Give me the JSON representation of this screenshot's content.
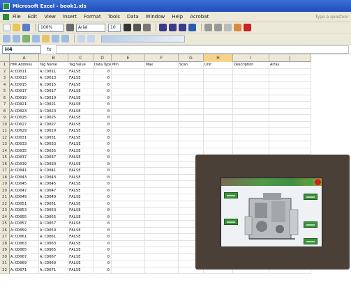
{
  "window": {
    "title": "Microsoft Excel - book1.xls"
  },
  "menu": {
    "items": [
      "File",
      "Edit",
      "View",
      "Insert",
      "Format",
      "Tools",
      "Data",
      "Window",
      "Help",
      "Acrobat"
    ],
    "help_placeholder": "Type a question"
  },
  "toolbar": {
    "zoom": "100%",
    "font": "Arial",
    "size": "10"
  },
  "formula": {
    "name_box": "H4",
    "fx": "fx",
    "value": ""
  },
  "columns": [
    "A",
    "B",
    "C",
    "D",
    "E",
    "F",
    "G",
    "H",
    "I",
    "J"
  ],
  "selected_column": "H",
  "header_row": [
    "HMI Address",
    "Tag Name",
    "Tag Value",
    "Data Type",
    "Min",
    "Max",
    "Scan",
    "Unit",
    "Description",
    "Array"
  ],
  "rows": [
    {
      "n": "2",
      "a": "A:CD011",
      "b": "A:CD011",
      "c": "FALSE",
      "d": "0"
    },
    {
      "n": "3",
      "a": "A:CD013",
      "b": "A:CD013",
      "c": "FALSE",
      "d": "0"
    },
    {
      "n": "4",
      "a": "A:CD015",
      "b": "A:CD015",
      "c": "FALSE",
      "d": "0"
    },
    {
      "n": "5",
      "a": "A:CD017",
      "b": "A:CD017",
      "c": "FALSE",
      "d": "0"
    },
    {
      "n": "6",
      "a": "A:CD019",
      "b": "A:CD019",
      "c": "FALSE",
      "d": "0"
    },
    {
      "n": "7",
      "a": "A:CD021",
      "b": "A:CD021",
      "c": "FALSE",
      "d": "0"
    },
    {
      "n": "8",
      "a": "A:CD023",
      "b": "A:CD023",
      "c": "FALSE",
      "d": "0"
    },
    {
      "n": "9",
      "a": "A:CD025",
      "b": "A:CD025",
      "c": "FALSE",
      "d": "0"
    },
    {
      "n": "10",
      "a": "A:CD027",
      "b": "A:CD027",
      "c": "FALSE",
      "d": "0"
    },
    {
      "n": "11",
      "a": "A:CD029",
      "b": "A:CD029",
      "c": "FALSE",
      "d": "0"
    },
    {
      "n": "12",
      "a": "A:CD031",
      "b": "A:CD031",
      "c": "FALSE",
      "d": "0"
    },
    {
      "n": "13",
      "a": "A:CD033",
      "b": "A:CD033",
      "c": "FALSE",
      "d": "0"
    },
    {
      "n": "14",
      "a": "A:CD035",
      "b": "A:CD035",
      "c": "FALSE",
      "d": "0"
    },
    {
      "n": "15",
      "a": "A:CD037",
      "b": "A:CD037",
      "c": "FALSE",
      "d": "0"
    },
    {
      "n": "16",
      "a": "A:CD039",
      "b": "A:CD039",
      "c": "FALSE",
      "d": "0"
    },
    {
      "n": "17",
      "a": "A:CD041",
      "b": "A:CD041",
      "c": "FALSE",
      "d": "0"
    },
    {
      "n": "18",
      "a": "A:CD043",
      "b": "A:CD043",
      "c": "FALSE",
      "d": "0"
    },
    {
      "n": "19",
      "a": "A:CD045",
      "b": "A:CD045",
      "c": "FALSE",
      "d": "0"
    },
    {
      "n": "20",
      "a": "A:CD047",
      "b": "A:CD047",
      "c": "FALSE",
      "d": "0"
    },
    {
      "n": "21",
      "a": "A:CD049",
      "b": "A:CD049",
      "c": "FALSE",
      "d": "0"
    },
    {
      "n": "22",
      "a": "A:CD051",
      "b": "A:CD051",
      "c": "FALSE",
      "d": "0"
    },
    {
      "n": "23",
      "a": "A:CD053",
      "b": "A:CD053",
      "c": "FALSE",
      "d": "0"
    },
    {
      "n": "24",
      "a": "A:CD055",
      "b": "A:CD055",
      "c": "FALSE",
      "d": "0"
    },
    {
      "n": "25",
      "a": "A:CD057",
      "b": "A:CD057",
      "c": "FALSE",
      "d": "0"
    },
    {
      "n": "26",
      "a": "A:CD059",
      "b": "A:CD059",
      "c": "FALSE",
      "d": "0"
    },
    {
      "n": "27",
      "a": "A:CD061",
      "b": "A:CD061",
      "c": "FALSE",
      "d": "0"
    },
    {
      "n": "28",
      "a": "A:CD063",
      "b": "A:CD063",
      "c": "FALSE",
      "d": "0"
    },
    {
      "n": "29",
      "a": "A:CD065",
      "b": "A:CD065",
      "c": "FALSE",
      "d": "0"
    },
    {
      "n": "30",
      "a": "A:CD067",
      "b": "A:CD067",
      "c": "FALSE",
      "d": "0"
    },
    {
      "n": "31",
      "a": "A:CD069",
      "b": "A:CD069",
      "c": "FALSE",
      "d": "0"
    },
    {
      "n": "32",
      "a": "A:CD071",
      "b": "A:CD071",
      "c": "FALSE",
      "d": "0"
    }
  ],
  "colors": {
    "titlebar": "#1f4fb8",
    "chrome": "#ece9d8",
    "selection": "#f7d48a",
    "device": "#4a4037"
  },
  "icons": [
    "excel-app-icon",
    "workbook-icon",
    "new-icon",
    "open-icon",
    "save-icon",
    "print-icon",
    "bold-icon",
    "italic-icon",
    "underline-icon",
    "align-icon"
  ]
}
